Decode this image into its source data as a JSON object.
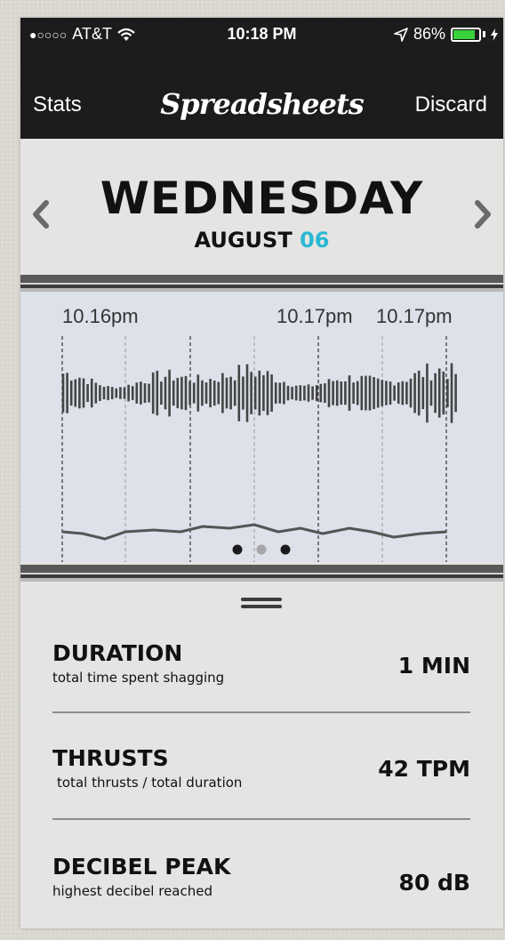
{
  "status_bar": {
    "signal": "●○○○○",
    "carrier": "AT&T",
    "time": "10:18 PM",
    "battery": "86%",
    "battery_level": 0.86
  },
  "nav": {
    "left_label": "Stats",
    "title": "Spreadsheets",
    "right_label": "Discard"
  },
  "date": {
    "day": "WEDNESDAY",
    "month": "AUGUST",
    "day_number": "06"
  },
  "timeline": {
    "labels": [
      "10.16pm",
      "10.17pm",
      "10.17pm"
    ],
    "pages": 3,
    "active_page": 1
  },
  "stats": [
    {
      "name": "DURATION",
      "description": "total time spent shagging",
      "value": "1 MIN"
    },
    {
      "name": "THRUSTS",
      "description": "total thrusts / total duration",
      "value": "42 TPM"
    },
    {
      "name": "DECIBEL PEAK",
      "description": "highest decibel reached",
      "value": "80 dB"
    }
  ],
  "colors": {
    "accent": "#2ab7d2",
    "bar": "#1c1c1c",
    "chart_bg": "#dce1ea",
    "battery": "#38d13a"
  },
  "icons": [
    "wifi-icon",
    "location-arrow-icon",
    "battery-icon",
    "charging-icon",
    "chevron-left-icon",
    "chevron-right-icon",
    "drag-handle-icon"
  ]
}
